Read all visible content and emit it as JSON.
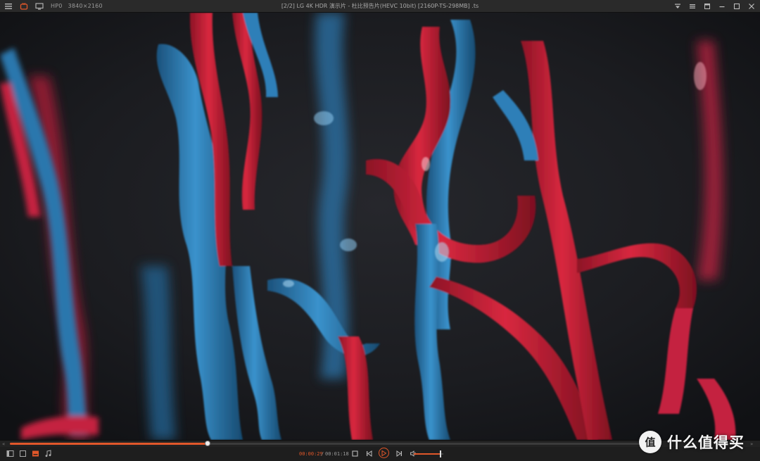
{
  "window": {
    "title": "[2/2] LG 4K HDR 演示片 - 杜比预告片(HEVC 10bit) [2160P-TS-298MB] .ts",
    "codec": "HP0",
    "resolution": "3840×2160"
  },
  "titlebar_icons": {
    "left": [
      "menu-icon",
      "logo-icon",
      "monitor-icon"
    ],
    "right": [
      "dropdown-icon",
      "settings-icon",
      "pin-icon",
      "minimize-icon",
      "maximize-icon",
      "close-icon"
    ]
  },
  "playback": {
    "progress": 0.31,
    "current_time": "00:00:29",
    "separator": "/",
    "total_time": "00:01:18",
    "volume": 0.9
  },
  "controls": {
    "left": [
      "playlist-icon",
      "stop-square-icon",
      "subtitle-icon",
      "music-icon"
    ],
    "center": [
      "stop-icon",
      "previous-icon",
      "play-icon",
      "next-icon",
      "volume-icon"
    ]
  },
  "watermark": {
    "logo": "值",
    "text": "什么值得买"
  },
  "colors": {
    "accent": "#e0572a",
    "paint_red": "#d4243f",
    "paint_blue": "#2f7fb8",
    "background": "#1b1c20"
  }
}
